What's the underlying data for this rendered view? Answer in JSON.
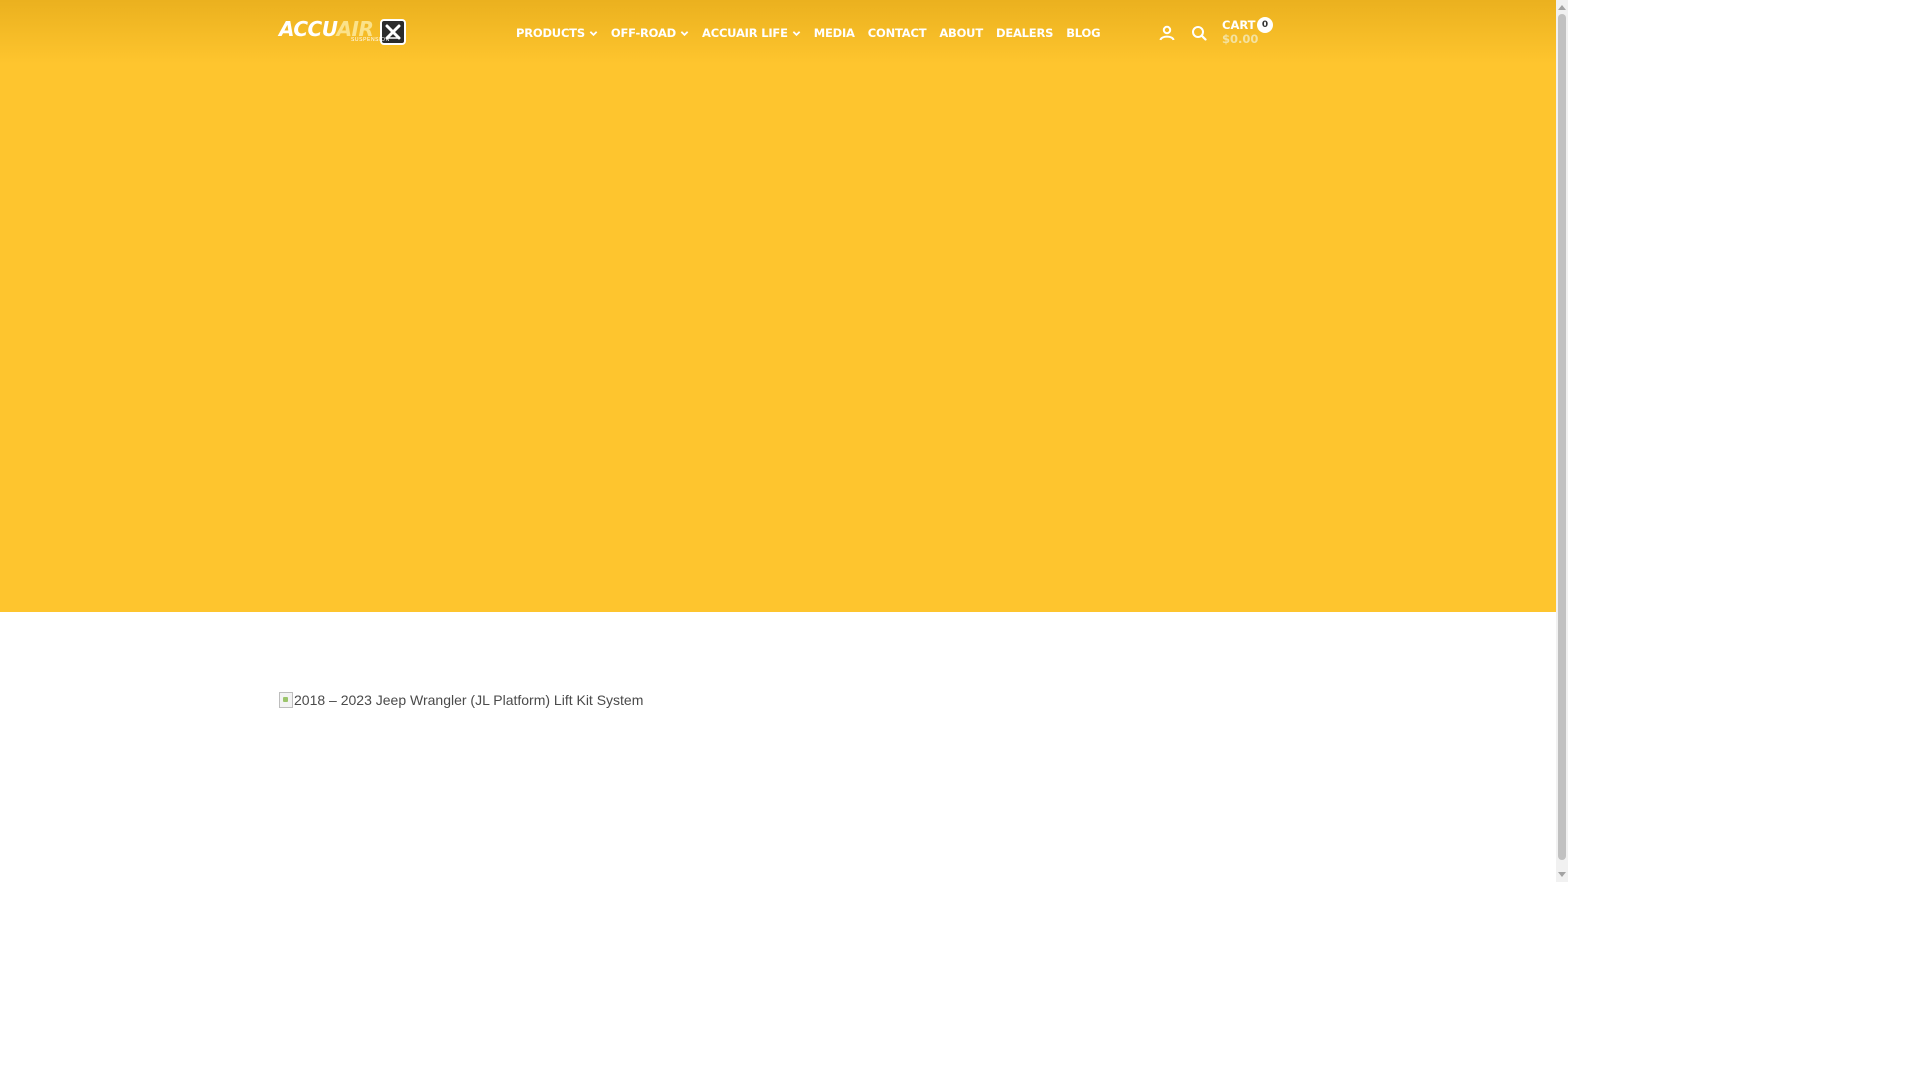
{
  "header": {
    "logo": {
      "word_primary": "ACCU",
      "word_accent": "AIR",
      "subtitle": "SUSPENSION"
    },
    "nav": [
      {
        "label": "PRODUCTS",
        "has_dropdown": true
      },
      {
        "label": "OFF-ROAD",
        "has_dropdown": true
      },
      {
        "label": "ACCUAIR LIFE",
        "has_dropdown": true
      },
      {
        "label": "MEDIA",
        "has_dropdown": false
      },
      {
        "label": "CONTACT",
        "has_dropdown": false
      },
      {
        "label": "ABOUT",
        "has_dropdown": false
      },
      {
        "label": "DEALERS",
        "has_dropdown": false
      },
      {
        "label": "BLOG",
        "has_dropdown": false
      }
    ],
    "icons": [
      "account-icon",
      "search-icon"
    ],
    "cart": {
      "label": "CART",
      "count": "0",
      "total": "$0.00"
    }
  },
  "hero": {
    "background_color": "#fec52e"
  },
  "product": {
    "image_alt": "2018 – 2023 Jeep Wrangler (JL Platform) Lift Kit System"
  }
}
